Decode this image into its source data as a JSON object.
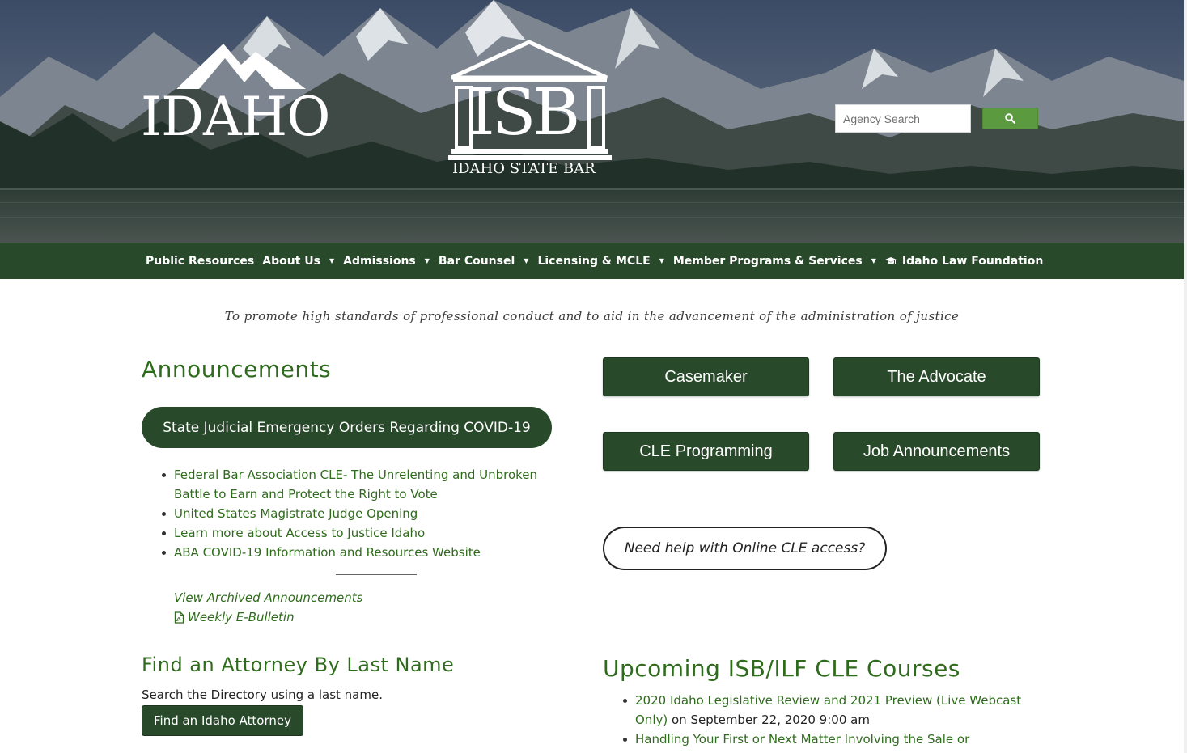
{
  "header": {
    "idaho_logo_text": "IDAHO",
    "isb_logo_letters": "ISB",
    "isb_logo_subtitle": "IDAHO STATE BAR",
    "search_placeholder": "Agency Search",
    "search_button_icon": "search-icon"
  },
  "nav": {
    "items": [
      {
        "label": "Public Resources",
        "has_dropdown": false
      },
      {
        "label": "About Us",
        "has_dropdown": true
      },
      {
        "label": "Admissions",
        "has_dropdown": true
      },
      {
        "label": "Bar Counsel",
        "has_dropdown": true
      },
      {
        "label": "Licensing & MCLE",
        "has_dropdown": true
      },
      {
        "label": "Member Programs & Services",
        "has_dropdown": true
      },
      {
        "label": "Idaho Law Foundation",
        "has_dropdown": false,
        "icon": "graduation-cap-icon"
      }
    ]
  },
  "tagline": "To promote high standards of professional conduct and to aid in the advancement of the administration of justice",
  "announcements": {
    "title": "Announcements",
    "featured_button": "State Judicial Emergency Orders Regarding COVID-19",
    "items": [
      "Federal Bar Association CLE- The Unrelenting and Unbroken Battle to Earn and Protect the Right to Vote",
      "United States Magistrate Judge Opening",
      "Learn more about Access to Justice Idaho",
      "ABA COVID-19 Information and Resources Website"
    ],
    "archived_link": "View Archived Announcements",
    "ebulletin_link": "Weekly E-Bulletin",
    "ebulletin_icon": "pdf-file-icon"
  },
  "find_attorney": {
    "title": "Find an Attorney By Last Name",
    "description": "Search the Directory using a last name.",
    "button": "Find an Idaho Attorney"
  },
  "quick_links": {
    "casemaker": "Casemaker",
    "advocate": "The Advocate",
    "cle_programming": "CLE Programming",
    "job_announcements": "Job Announcements",
    "help_button": "Need help with Online CLE access?"
  },
  "cle_courses": {
    "title": "Upcoming ISB/ILF CLE Courses",
    "items": [
      {
        "link": "2020 Idaho Legislative Review and 2021 Preview (Live Webcast Only)",
        "suffix": " on September 22, 2020 9:00 am"
      },
      {
        "link": "Handling Your First or Next Matter Involving the Sale or",
        "suffix": ""
      }
    ]
  },
  "colors": {
    "nav_bg": "#29492b",
    "heading_green": "#2f6b1c",
    "search_button": "#5b9a3e"
  }
}
